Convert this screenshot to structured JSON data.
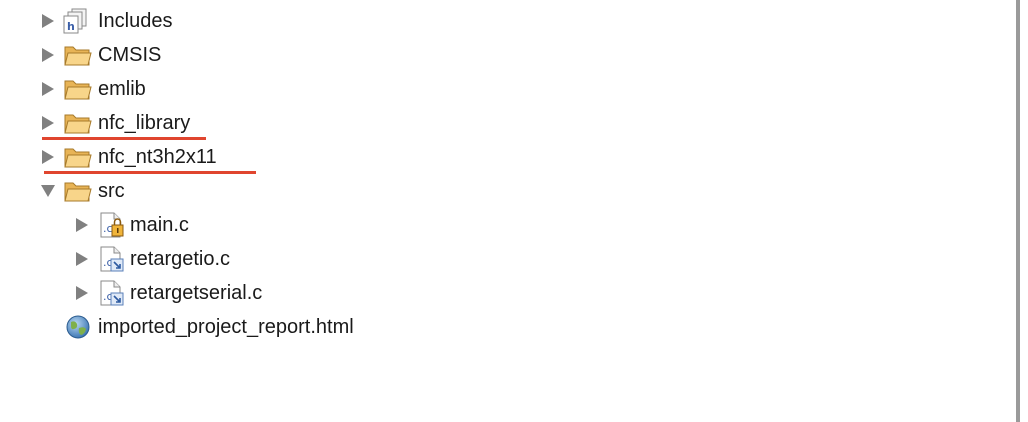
{
  "project_tree": {
    "items": [
      {
        "label": "Includes",
        "icon": "includes-icon",
        "expanded": false
      },
      {
        "label": "CMSIS",
        "icon": "folder-icon",
        "expanded": false
      },
      {
        "label": "emlib",
        "icon": "folder-icon",
        "expanded": false
      },
      {
        "label": "nfc_library",
        "icon": "folder-icon",
        "expanded": false,
        "highlighted": true
      },
      {
        "label": "nfc_nt3h2x11",
        "icon": "folder-icon",
        "expanded": false,
        "highlighted": true
      },
      {
        "label": "src",
        "icon": "folder-icon",
        "expanded": true,
        "children": [
          {
            "label": "main.c",
            "icon": "c-source-file-locked-icon"
          },
          {
            "label": "retargetio.c",
            "icon": "c-source-file-linked-icon"
          },
          {
            "label": "retargetserial.c",
            "icon": "c-source-file-linked-icon"
          }
        ]
      },
      {
        "label": "imported_project_report.html",
        "icon": "globe-html-icon"
      }
    ]
  },
  "colors": {
    "highlight_underline": "#e0452f",
    "folder": "#f3c46b",
    "twisty": "#808080"
  }
}
